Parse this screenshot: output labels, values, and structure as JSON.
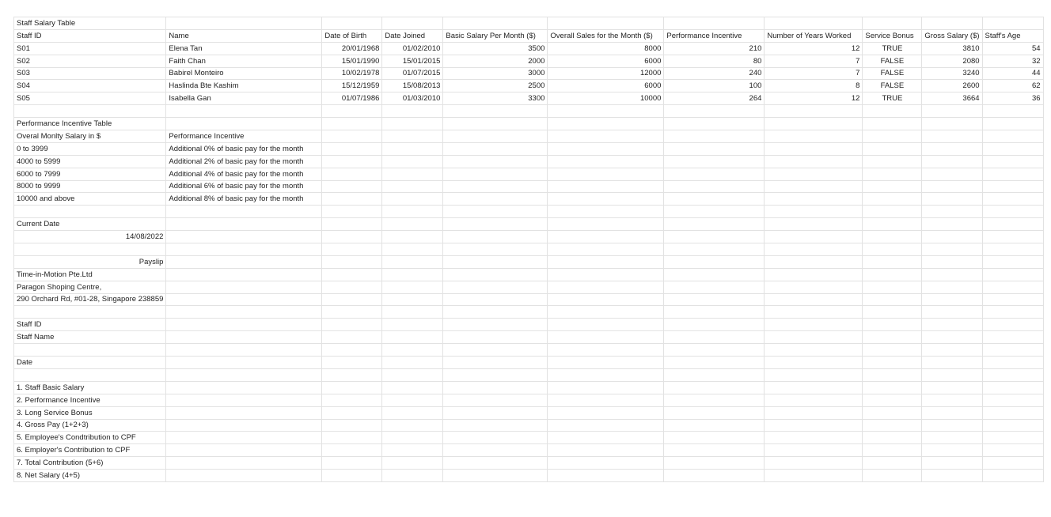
{
  "sheet": {
    "columns": [
      176,
      197,
      76,
      77,
      132,
      147,
      127,
      124,
      75,
      75,
      77
    ],
    "rows": [
      [
        {
          "t": "Staff Salary Table"
        },
        {},
        {},
        {},
        {},
        {},
        {},
        {},
        {},
        {},
        {}
      ],
      [
        {
          "t": "Staff ID"
        },
        {
          "t": "Name"
        },
        {
          "t": "Date of Birth"
        },
        {
          "t": "Date Joined"
        },
        {
          "t": "Basic Salary Per Month ($)"
        },
        {
          "t": "Overall Sales for the Month ($)"
        },
        {
          "t": "Performance Incentive"
        },
        {
          "t": "Number of Years Worked"
        },
        {
          "t": "Service Bonus"
        },
        {
          "t": "Gross Salary ($)"
        },
        {
          "t": "Staff's Age"
        }
      ],
      [
        {
          "t": "S01"
        },
        {
          "t": "Elena Tan"
        },
        {
          "t": "20/01/1968",
          "a": "r"
        },
        {
          "t": "01/02/2010",
          "a": "r"
        },
        {
          "t": "3500",
          "a": "r"
        },
        {
          "t": "8000",
          "a": "r"
        },
        {
          "t": "210",
          "a": "r"
        },
        {
          "t": "12",
          "a": "r"
        },
        {
          "t": "TRUE",
          "a": "c"
        },
        {
          "t": "3810",
          "a": "r"
        },
        {
          "t": "54",
          "a": "r"
        }
      ],
      [
        {
          "t": "S02"
        },
        {
          "t": "Faith Chan"
        },
        {
          "t": "15/01/1990",
          "a": "r"
        },
        {
          "t": "15/01/2015",
          "a": "r"
        },
        {
          "t": "2000",
          "a": "r"
        },
        {
          "t": "6000",
          "a": "r"
        },
        {
          "t": "80",
          "a": "r"
        },
        {
          "t": "7",
          "a": "r"
        },
        {
          "t": "FALSE",
          "a": "c"
        },
        {
          "t": "2080",
          "a": "r"
        },
        {
          "t": "32",
          "a": "r"
        }
      ],
      [
        {
          "t": "S03"
        },
        {
          "t": "Babirel Monteiro"
        },
        {
          "t": "10/02/1978",
          "a": "r"
        },
        {
          "t": "01/07/2015",
          "a": "r"
        },
        {
          "t": "3000",
          "a": "r"
        },
        {
          "t": "12000",
          "a": "r"
        },
        {
          "t": "240",
          "a": "r"
        },
        {
          "t": "7",
          "a": "r"
        },
        {
          "t": "FALSE",
          "a": "c"
        },
        {
          "t": "3240",
          "a": "r"
        },
        {
          "t": "44",
          "a": "r"
        }
      ],
      [
        {
          "t": "S04"
        },
        {
          "t": "Haslinda Bte Kashim"
        },
        {
          "t": "15/12/1959",
          "a": "r"
        },
        {
          "t": "15/08/2013",
          "a": "r"
        },
        {
          "t": "2500",
          "a": "r"
        },
        {
          "t": "6000",
          "a": "r"
        },
        {
          "t": "100",
          "a": "r"
        },
        {
          "t": "8",
          "a": "r"
        },
        {
          "t": "FALSE",
          "a": "c"
        },
        {
          "t": "2600",
          "a": "r"
        },
        {
          "t": "62",
          "a": "r"
        }
      ],
      [
        {
          "t": "S05"
        },
        {
          "t": "Isabella Gan"
        },
        {
          "t": "01/07/1986",
          "a": "r"
        },
        {
          "t": "01/03/2010",
          "a": "r"
        },
        {
          "t": "3300",
          "a": "r"
        },
        {
          "t": "10000",
          "a": "r"
        },
        {
          "t": "264",
          "a": "r"
        },
        {
          "t": "12",
          "a": "r"
        },
        {
          "t": "TRUE",
          "a": "c"
        },
        {
          "t": "3664",
          "a": "r"
        },
        {
          "t": "36",
          "a": "r"
        }
      ],
      [
        {},
        {},
        {},
        {},
        {},
        {},
        {},
        {},
        {},
        {},
        {}
      ],
      [
        {
          "t": "Performance Incentive Table"
        },
        {},
        {},
        {},
        {},
        {},
        {},
        {},
        {},
        {},
        {}
      ],
      [
        {
          "t": "Overal Monlty Salary in $"
        },
        {
          "t": "Performance Incentive"
        },
        {},
        {},
        {},
        {},
        {},
        {},
        {},
        {},
        {}
      ],
      [
        {
          "t": "0 to 3999"
        },
        {
          "t": "Additional 0% of basic pay for the month"
        },
        {},
        {},
        {},
        {},
        {},
        {},
        {},
        {},
        {}
      ],
      [
        {
          "t": "4000 to 5999"
        },
        {
          "t": "Additional 2% of basic pay for the month"
        },
        {},
        {},
        {},
        {},
        {},
        {},
        {},
        {},
        {}
      ],
      [
        {
          "t": "6000 to 7999"
        },
        {
          "t": "Additional 4% of basic pay for the month"
        },
        {},
        {},
        {},
        {},
        {},
        {},
        {},
        {},
        {}
      ],
      [
        {
          "t": "8000 to 9999"
        },
        {
          "t": "Additional 6% of basic pay for the month"
        },
        {},
        {},
        {},
        {},
        {},
        {},
        {},
        {},
        {}
      ],
      [
        {
          "t": "10000 and above"
        },
        {
          "t": "Additional 8% of basic pay for the month"
        },
        {},
        {},
        {},
        {},
        {},
        {},
        {},
        {},
        {}
      ],
      [
        {},
        {},
        {},
        {},
        {},
        {},
        {},
        {},
        {},
        {},
        {}
      ],
      [
        {
          "t": "Current Date"
        },
        {},
        {},
        {},
        {},
        {},
        {},
        {},
        {},
        {},
        {}
      ],
      [
        {
          "t": "14/08/2022",
          "a": "r"
        },
        {},
        {},
        {},
        {},
        {},
        {},
        {},
        {},
        {},
        {}
      ],
      [
        {},
        {},
        {},
        {},
        {},
        {},
        {},
        {},
        {},
        {},
        {}
      ],
      [
        {
          "t": "Payslip",
          "a": "r"
        },
        {},
        {},
        {},
        {},
        {},
        {},
        {},
        {},
        {},
        {}
      ],
      [
        {
          "t": "Time-in-Motion Pte.Ltd"
        },
        {},
        {},
        {},
        {},
        {},
        {},
        {},
        {},
        {},
        {}
      ],
      [
        {
          "t": "Paragon Shoping Centre,"
        },
        {},
        {},
        {},
        {},
        {},
        {},
        {},
        {},
        {},
        {}
      ],
      [
        {
          "t": "290 Orchard Rd, #01-28, Singapore 238859"
        },
        {},
        {},
        {},
        {},
        {},
        {},
        {},
        {},
        {},
        {}
      ],
      [
        {},
        {},
        {},
        {},
        {},
        {},
        {},
        {},
        {},
        {},
        {}
      ],
      [
        {
          "t": "Staff ID"
        },
        {},
        {},
        {},
        {},
        {},
        {},
        {},
        {},
        {},
        {}
      ],
      [
        {
          "t": "Staff Name"
        },
        {},
        {},
        {},
        {},
        {},
        {},
        {},
        {},
        {},
        {}
      ],
      [
        {},
        {},
        {},
        {},
        {},
        {},
        {},
        {},
        {},
        {},
        {}
      ],
      [
        {
          "t": "Date"
        },
        {},
        {},
        {},
        {},
        {},
        {},
        {},
        {},
        {},
        {}
      ],
      [
        {},
        {},
        {},
        {},
        {},
        {},
        {},
        {},
        {},
        {},
        {}
      ],
      [
        {
          "t": "1. Staff Basic Salary"
        },
        {},
        {},
        {},
        {},
        {},
        {},
        {},
        {},
        {},
        {}
      ],
      [
        {
          "t": "2. Performance Incentive"
        },
        {},
        {},
        {},
        {},
        {},
        {},
        {},
        {},
        {},
        {}
      ],
      [
        {
          "t": "3. Long Service Bonus"
        },
        {},
        {},
        {},
        {},
        {},
        {},
        {},
        {},
        {},
        {}
      ],
      [
        {
          "t": "4. Gross Pay (1+2+3)"
        },
        {},
        {},
        {},
        {},
        {},
        {},
        {},
        {},
        {},
        {}
      ],
      [
        {
          "t": "5. Employee's Condtribution to CPF"
        },
        {},
        {},
        {},
        {},
        {},
        {},
        {},
        {},
        {},
        {}
      ],
      [
        {
          "t": "6. Employer's Contribution to CPF"
        },
        {},
        {},
        {},
        {},
        {},
        {},
        {},
        {},
        {},
        {}
      ],
      [
        {
          "t": "7. Total Contribution (5+6)"
        },
        {},
        {},
        {},
        {},
        {},
        {},
        {},
        {},
        {},
        {}
      ],
      [
        {
          "t": "8. Net Salary (4+5)"
        },
        {},
        {},
        {},
        {},
        {},
        {},
        {},
        {},
        {},
        {}
      ]
    ]
  }
}
